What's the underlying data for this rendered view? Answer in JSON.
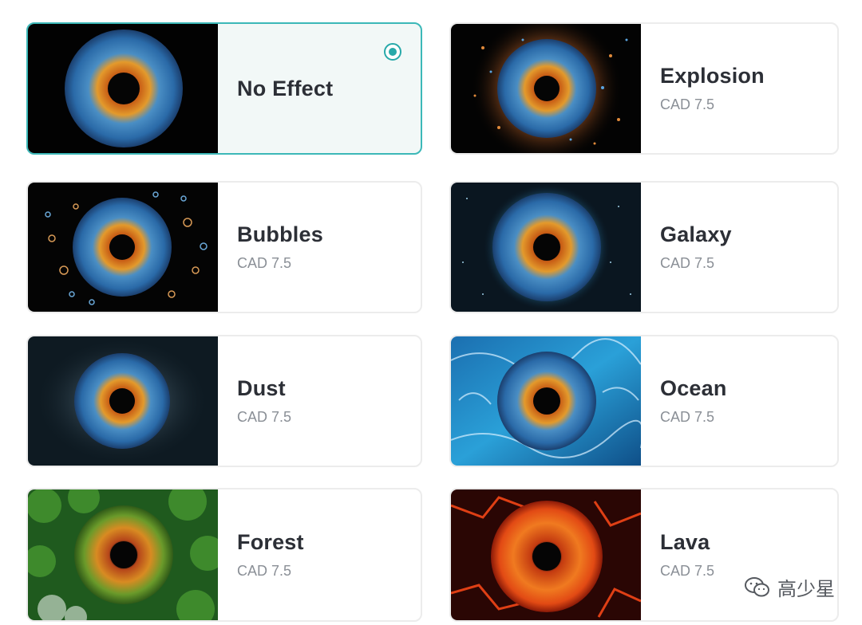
{
  "effects": [
    {
      "name": "No Effect",
      "price": "",
      "theme": "black",
      "selected": true
    },
    {
      "name": "Explosion",
      "price": "CAD 7.5",
      "theme": "explosion",
      "selected": false
    },
    {
      "name": "Bubbles",
      "price": "CAD 7.5",
      "theme": "bubbles",
      "selected": false
    },
    {
      "name": "Galaxy",
      "price": "CAD 7.5",
      "theme": "galaxy",
      "selected": false
    },
    {
      "name": "Dust",
      "price": "CAD 7.5",
      "theme": "dust",
      "selected": false
    },
    {
      "name": "Ocean",
      "price": "CAD 7.5",
      "theme": "ocean",
      "selected": false
    },
    {
      "name": "Forest",
      "price": "CAD 7.5",
      "theme": "forest",
      "selected": false
    },
    {
      "name": "Lava",
      "price": "CAD 7.5",
      "theme": "lava",
      "selected": false
    }
  ],
  "watermark": {
    "text": "高少星",
    "icon": "wechat-icon"
  },
  "colors": {
    "accent": "#27a9a9",
    "title": "#2c2f36",
    "price": "#8a8f96"
  }
}
